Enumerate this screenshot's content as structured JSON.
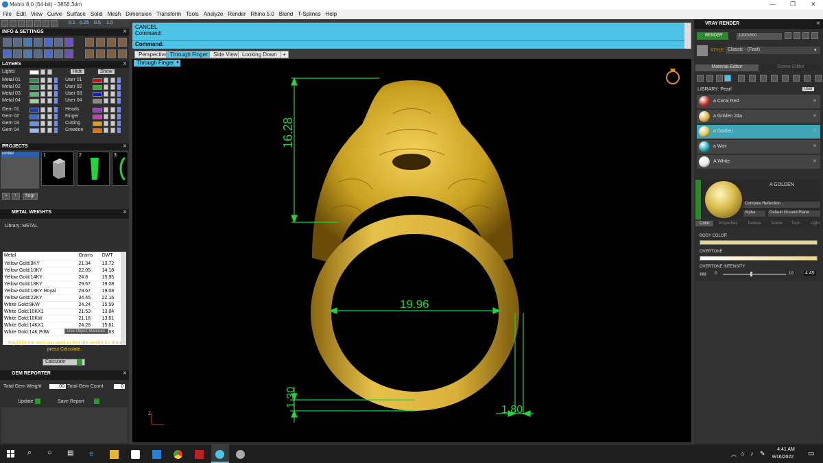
{
  "window": {
    "title": "Matrix 8.0 (64-bit) - 3858.3dm",
    "minimize": "—",
    "restore": "❐",
    "close": "✕"
  },
  "menu": [
    "File",
    "Edit",
    "View",
    "Curve",
    "Surface",
    "Solid",
    "Mesh",
    "Dimension",
    "Transform",
    "Tools",
    "Analyze",
    "Render",
    "Rhino 5.0",
    "Blend",
    "T-Splines",
    "Help"
  ],
  "toolbar_values": [
    "0.1",
    "0.25",
    "0.5",
    "1.0"
  ],
  "left": {
    "info_header": "INFO & SETTINGS",
    "layers_header": "LAYERS",
    "lights_label": "Lights",
    "hide_label": "Hide",
    "show_label": "Show",
    "layers": [
      {
        "name": "Metal 01",
        "color": "#2e8b57"
      },
      {
        "name": "Metal 02",
        "color": "#2fa85a"
      },
      {
        "name": "Metal 03",
        "color": "#4cc06a"
      },
      {
        "name": "Metal 04",
        "color": "#8fd99a"
      },
      {
        "name": "Gem 01",
        "color": "#1f3fa0"
      },
      {
        "name": "Gem 02",
        "color": "#3a6ad0"
      },
      {
        "name": "Gem 03",
        "color": "#6f94e0"
      },
      {
        "name": "Gem 04",
        "color": "#9ab6ee"
      }
    ],
    "layers_right": [
      {
        "name": "User 01",
        "color": "#d01010"
      },
      {
        "name": "User 02",
        "color": "#18c018"
      },
      {
        "name": "User 03",
        "color": "#1020d0"
      },
      {
        "name": "User 04",
        "color": "#8a8a8a"
      },
      {
        "name": "Heads",
        "color": "#9a40c0"
      },
      {
        "name": "Finger",
        "color": "#c040b0"
      },
      {
        "name": "Cutting",
        "color": "#e0a020"
      },
      {
        "name": "Creation",
        "color": "#e07010"
      }
    ],
    "projects_header": "PROJECTS",
    "project_item": "render",
    "project_nums": [
      "1",
      "2",
      "3"
    ],
    "metal_weights_header": "METAL WEIGHTS",
    "library_label": "Library: METAL",
    "columns": [
      "Metal",
      "Grams",
      "DWT"
    ],
    "rows": [
      [
        "Yellow Gold:9KY",
        "21.34",
        "13.72"
      ],
      [
        "Yellow Gold:10KY",
        "22.05",
        "14.18"
      ],
      [
        "Yellow Gold:14KY",
        "24.8",
        "15.95"
      ],
      [
        "Yellow Gold:18KY",
        "29.67",
        "19.08"
      ],
      [
        "Yellow Gold:18KY Royal",
        "29.67",
        "19.08"
      ],
      [
        "Yellow Gold:22KY",
        "34.45",
        "22.15"
      ],
      [
        "White Gold:9KW",
        "24.24",
        "15.59"
      ],
      [
        "White Gold:10KX1",
        "21.53",
        "13.84"
      ],
      [
        "White Gold:10KW",
        "21.16",
        "13.61"
      ],
      [
        "White Gold:14KX1",
        "24.28",
        "15.61"
      ],
      [
        "White Gold:14K PdW",
        "27.73",
        "17.83"
      ]
    ],
    "use_object_materials": "Use Object Materials",
    "hint": "Highlight the item you want to find the weight for then press Calculate.",
    "calculate": "Calculate",
    "gem_header": "GEM REPORTER",
    "total_gem_weight_label": "Total Gem Weight",
    "total_gem_weight": ".00",
    "total_gem_count_label": "Total Gem Count",
    "total_gem_count": "0",
    "update": "Update",
    "save_report": "Save Report",
    "fingr": "fingr"
  },
  "command": {
    "line1": "CANCEL",
    "line2": "Command:",
    "prompt": "Command:"
  },
  "view_tabs": [
    "Perspective",
    "Through Finger",
    "Side View",
    "Looking Down",
    "+"
  ],
  "active_tab": "Through Finger",
  "viewport_label": "Through Finger",
  "dimensions": {
    "height": "16.28",
    "inner_diameter": "19.96",
    "shank_thickness": "1.30",
    "shank_width": "1.80"
  },
  "axis_label": "Z",
  "right": {
    "vray_header": "VRAY RENDER",
    "render_btn": "RENDER",
    "resolution": "1200x900",
    "style_label": "STYLE:",
    "style_value": "Classic - (Fast)",
    "material_editor": "Material Editor",
    "scene_editor": "Scene Editor",
    "library_label": "LIBRARY: Pearl",
    "user_label": "User",
    "materials": [
      {
        "name": "a Coral Red",
        "color": "#c0302a"
      },
      {
        "name": "a Golden 24a",
        "color": "#d9b548"
      },
      {
        "name": "a Golden",
        "color": "#e1c25a"
      },
      {
        "name": "a Wax",
        "color": "#1aa8b8"
      },
      {
        "name": "A White",
        "color": "#e8e8e8"
      }
    ],
    "selected_material": "A GOLDEN",
    "reflection_label": "Complex Reflection",
    "alpha_label": "Alpha",
    "ground_plane": "Default Ground Plane",
    "sub_tabs": [
      "Color",
      "Properties",
      "Texture",
      "Scene",
      "Toon",
      "Light"
    ],
    "body_color": "BODY COLOR",
    "overtone": "OVERTONE",
    "overtone_intensity": "OVERTONE INTENSITY",
    "slider_min": "0",
    "slider_max": "10",
    "intensity_value": "4.45"
  },
  "taskbar": {
    "time": "4:41 AM",
    "date": "9/16/2022"
  },
  "colors": {
    "cyan": "#4fc3e6",
    "gold": "#c9a22a",
    "dim_green": "#22d43a"
  }
}
